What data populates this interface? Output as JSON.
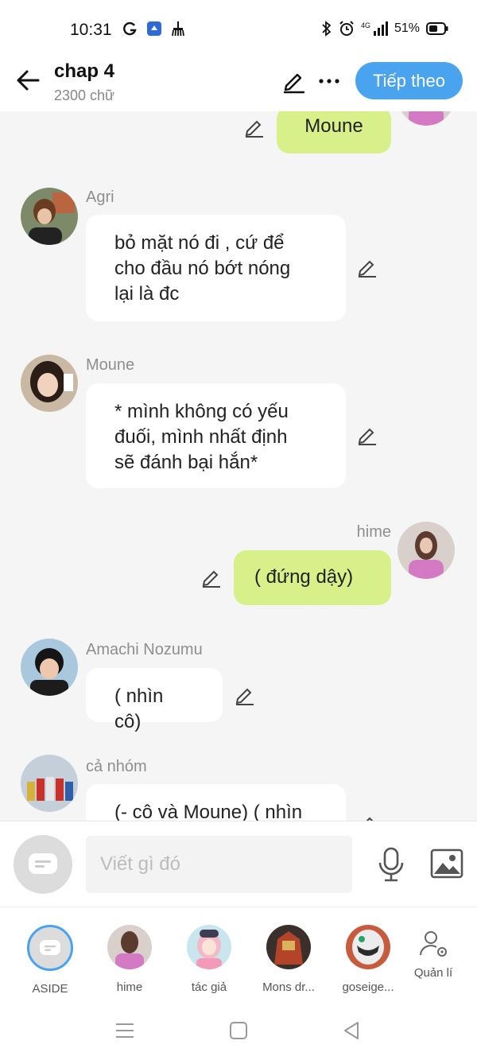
{
  "status": {
    "time": "10:31",
    "battery": "51%",
    "network": "4G"
  },
  "header": {
    "title": "chap 4",
    "subtitle": "2300 chữ",
    "next_label": "Tiếp theo"
  },
  "messages": [
    {
      "side": "right",
      "name": "",
      "text": "Moune"
    },
    {
      "side": "left",
      "name": "Agri",
      "text": "bỏ mặt nó đi , cứ để\ncho đầu nó bớt nóng\nlại là đc"
    },
    {
      "side": "left",
      "name": "Moune",
      "text": "* mình không có yếu\nđuối, mình nhất định\nsẽ đánh bại hắn*"
    },
    {
      "side": "right",
      "name": "hime",
      "text": "( đứng dậy)"
    },
    {
      "side": "left",
      "name": "Amachi Nozumu",
      "text": "( nhìn cô)"
    },
    {
      "side": "left",
      "name": "cả nhóm",
      "text": "(- cô và Moune) ( nhìn"
    }
  ],
  "composer": {
    "placeholder": "Viết gì đó"
  },
  "characters": [
    {
      "label": "ASIDE"
    },
    {
      "label": "hime"
    },
    {
      "label": "tác giả"
    },
    {
      "label": "Mons dr..."
    },
    {
      "label": "goseige..."
    },
    {
      "label": "Quản lí"
    }
  ],
  "colors": {
    "accent": "#4aa3ef",
    "own_bubble": "#d8f08a",
    "other_bubble": "#ffffff"
  }
}
